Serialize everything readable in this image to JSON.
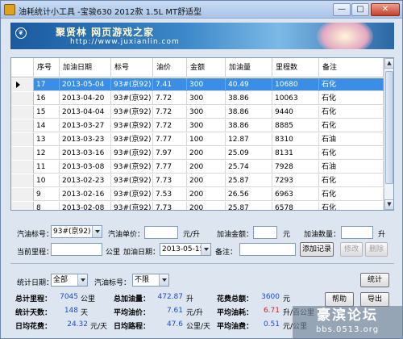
{
  "window": {
    "title": "油耗统计小工具 -宝骏630 2012款 1.5L MT舒适型",
    "min": "—",
    "max": "□",
    "close": "✕"
  },
  "banner": {
    "logo": "❦",
    "title": "聚贤林  网页游戏之家",
    "url": "http://www.juxianlin.com"
  },
  "grid": {
    "columns": [
      "序号",
      "加油日期",
      "标号",
      "油价",
      "金额",
      "加油量",
      "里程数",
      "备注"
    ],
    "rows": [
      {
        "id": "17",
        "date": "2013-05-04",
        "grade": "93#(京92)",
        "price": "7.41",
        "amount": "300",
        "volume": "40.49",
        "mileage": "10680",
        "note": "石化",
        "selected": true
      },
      {
        "id": "16",
        "date": "2013-04-20",
        "grade": "93#(京92)",
        "price": "7.72",
        "amount": "300",
        "volume": "38.86",
        "mileage": "10063",
        "note": "石化"
      },
      {
        "id": "15",
        "date": "2013-04-04",
        "grade": "93#(京92)",
        "price": "7.72",
        "amount": "300",
        "volume": "38.86",
        "mileage": "9440",
        "note": "石化"
      },
      {
        "id": "14",
        "date": "2013-03-27",
        "grade": "93#(京92)",
        "price": "7.72",
        "amount": "300",
        "volume": "38.86",
        "mileage": "8885",
        "note": "石化"
      },
      {
        "id": "13",
        "date": "2013-03-23",
        "grade": "93#(京92)",
        "price": "7.77",
        "amount": "100",
        "volume": "12.87",
        "mileage": "8310",
        "note": "石油"
      },
      {
        "id": "12",
        "date": "2013-03-16",
        "grade": "93#(京92)",
        "price": "7.97",
        "amount": "200",
        "volume": "25.09",
        "mileage": "8131",
        "note": "石化"
      },
      {
        "id": "11",
        "date": "2013-03-08",
        "grade": "93#(京92)",
        "price": "7.77",
        "amount": "200",
        "volume": "25.74",
        "mileage": "7928",
        "note": "石油"
      },
      {
        "id": "10",
        "date": "2013-02-23",
        "grade": "93#(京92)",
        "price": "7.73",
        "amount": "200",
        "volume": "25.87",
        "mileage": "7293",
        "note": "石化"
      },
      {
        "id": "9",
        "date": "2013-02-16",
        "grade": "93#(京92)",
        "price": "7.53",
        "amount": "200",
        "volume": "26.56",
        "mileage": "6963",
        "note": "石化"
      },
      {
        "id": "8",
        "date": "2013-02-08",
        "grade": "93#(京92)",
        "price": "7.73",
        "amount": "200",
        "volume": "25.87",
        "mileage": "6578",
        "note": "石化"
      }
    ]
  },
  "form": {
    "grade_label": "汽油标号：",
    "grade_value": "93#(京92)",
    "price_label": "汽油单价：",
    "price_value": "",
    "price_unit": "元/升",
    "amount_label": "加油金额：",
    "amount_value": "",
    "amount_unit": "元",
    "volume_label": "加油数量：",
    "volume_value": "",
    "volume_unit": "升",
    "mileage_label": "当前里程：",
    "mileage_value": "",
    "mileage_unit": "公里",
    "date_label": "加油日期：",
    "date_value": "2013-05-15",
    "note_label": "备注：",
    "note_value": "",
    "add_button": "添加记录",
    "edit_button": "修改",
    "delete_button": "删除"
  },
  "filter": {
    "period_label": "统计日期：",
    "period_value": "全部",
    "grade_label": "汽油标号：",
    "grade_value": "不限",
    "stats_button": "统计"
  },
  "stats": {
    "total_mileage_label": "总计里程：",
    "total_mileage_value": "7045",
    "total_mileage_unit": "公里",
    "total_fuel_label": "总加油量：",
    "total_fuel_value": "472.87",
    "total_fuel_unit": "升",
    "total_cost_label": "花费总额：",
    "total_cost_value": "3600",
    "total_cost_unit": "元",
    "days_label": "统计天数：",
    "days_value": "148",
    "days_unit": "天",
    "avg_price_label": "平均油价：",
    "avg_price_value": "7.61",
    "avg_price_unit": "元/升",
    "avg_consumption_label": "平均油耗：",
    "avg_consumption_value": "6.71",
    "avg_consumption_unit": "升/百公里",
    "daily_cost_label": "日均花费：",
    "daily_cost_value": "24.32",
    "daily_cost_unit": "元/天",
    "daily_distance_label": "日均路程：",
    "daily_distance_value": "47.6",
    "daily_distance_unit": "公里/天",
    "avg_fuel_cost_label": "平均油费：",
    "avg_fuel_cost_value": "0.51",
    "avg_fuel_cost_unit": "元/公里",
    "help_button": "帮助",
    "export_button": "导出"
  },
  "watermark": {
    "title": "豪滨论坛",
    "url": "bbs.0513.org"
  },
  "colors": {
    "selection": "#3a8ee6",
    "value_text": "#1b4bd0",
    "avg_consumption_text": "#d02020"
  }
}
